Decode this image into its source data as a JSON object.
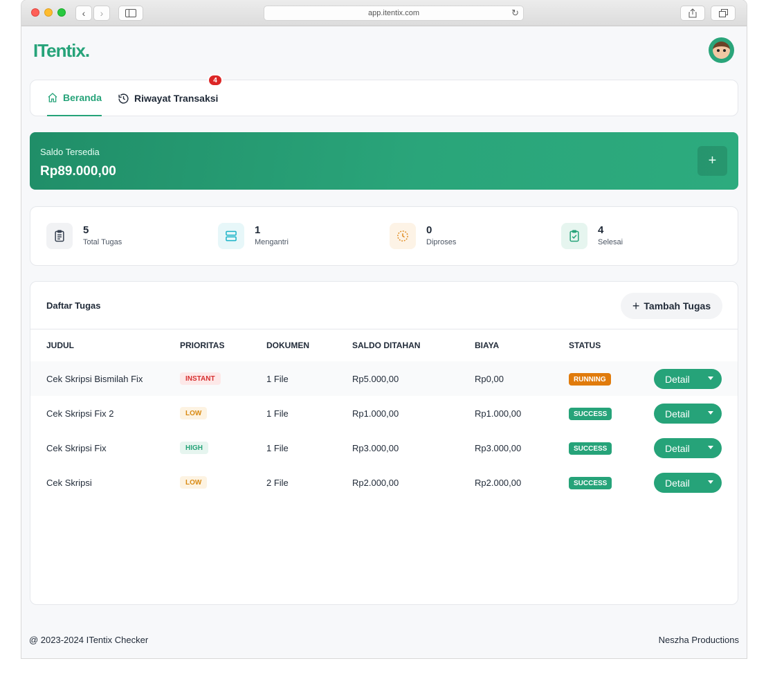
{
  "browser": {
    "url": "app.itentix.com"
  },
  "brand": {
    "logo": "ITentix."
  },
  "tabs": [
    {
      "label": "Beranda"
    },
    {
      "label": "Riwayat Transaksi",
      "badge": "4"
    }
  ],
  "balance": {
    "label": "Saldo Tersedia",
    "amount": "Rp89.000,00",
    "add": "+"
  },
  "stats": [
    {
      "value": "5",
      "label": "Total Tugas",
      "icon": "clipboard-list-icon"
    },
    {
      "value": "1",
      "label": "Mengantri",
      "icon": "server-stack-icon"
    },
    {
      "value": "0",
      "label": "Diproses",
      "icon": "clock-icon"
    },
    {
      "value": "4",
      "label": "Selesai",
      "icon": "clipboard-check-icon"
    }
  ],
  "tasks": {
    "title": "Daftar Tugas",
    "add_label": "Tambah Tugas",
    "columns": [
      "JUDUL",
      "PRIORITAS",
      "DOKUMEN",
      "SALDO DITAHAN",
      "BIAYA",
      "STATUS"
    ],
    "rows": [
      {
        "title": "Cek Skripsi Bismilah Fix",
        "priority": "INSTANT",
        "documents": "1 File",
        "held": "Rp5.000,00",
        "fee": "Rp0,00",
        "status": "RUNNING",
        "action": "Detail"
      },
      {
        "title": "Cek Skripsi Fix 2",
        "priority": "LOW",
        "documents": "1 File",
        "held": "Rp1.000,00",
        "fee": "Rp1.000,00",
        "status": "SUCCESS",
        "action": "Detail"
      },
      {
        "title": "Cek Skripsi Fix",
        "priority": "HIGH",
        "documents": "1 File",
        "held": "Rp3.000,00",
        "fee": "Rp3.000,00",
        "status": "SUCCESS",
        "action": "Detail"
      },
      {
        "title": "Cek Skripsi",
        "priority": "LOW",
        "documents": "2 File",
        "held": "Rp2.000,00",
        "fee": "Rp2.000,00",
        "status": "SUCCESS",
        "action": "Detail"
      }
    ]
  },
  "footer": {
    "left": "@ 2023-2024 ITentix Checker",
    "right": "Neszha Productions"
  },
  "colors": {
    "brand": "#26a379",
    "running": "#e07b0c",
    "success": "#26a379",
    "badge": "#dc2626"
  }
}
